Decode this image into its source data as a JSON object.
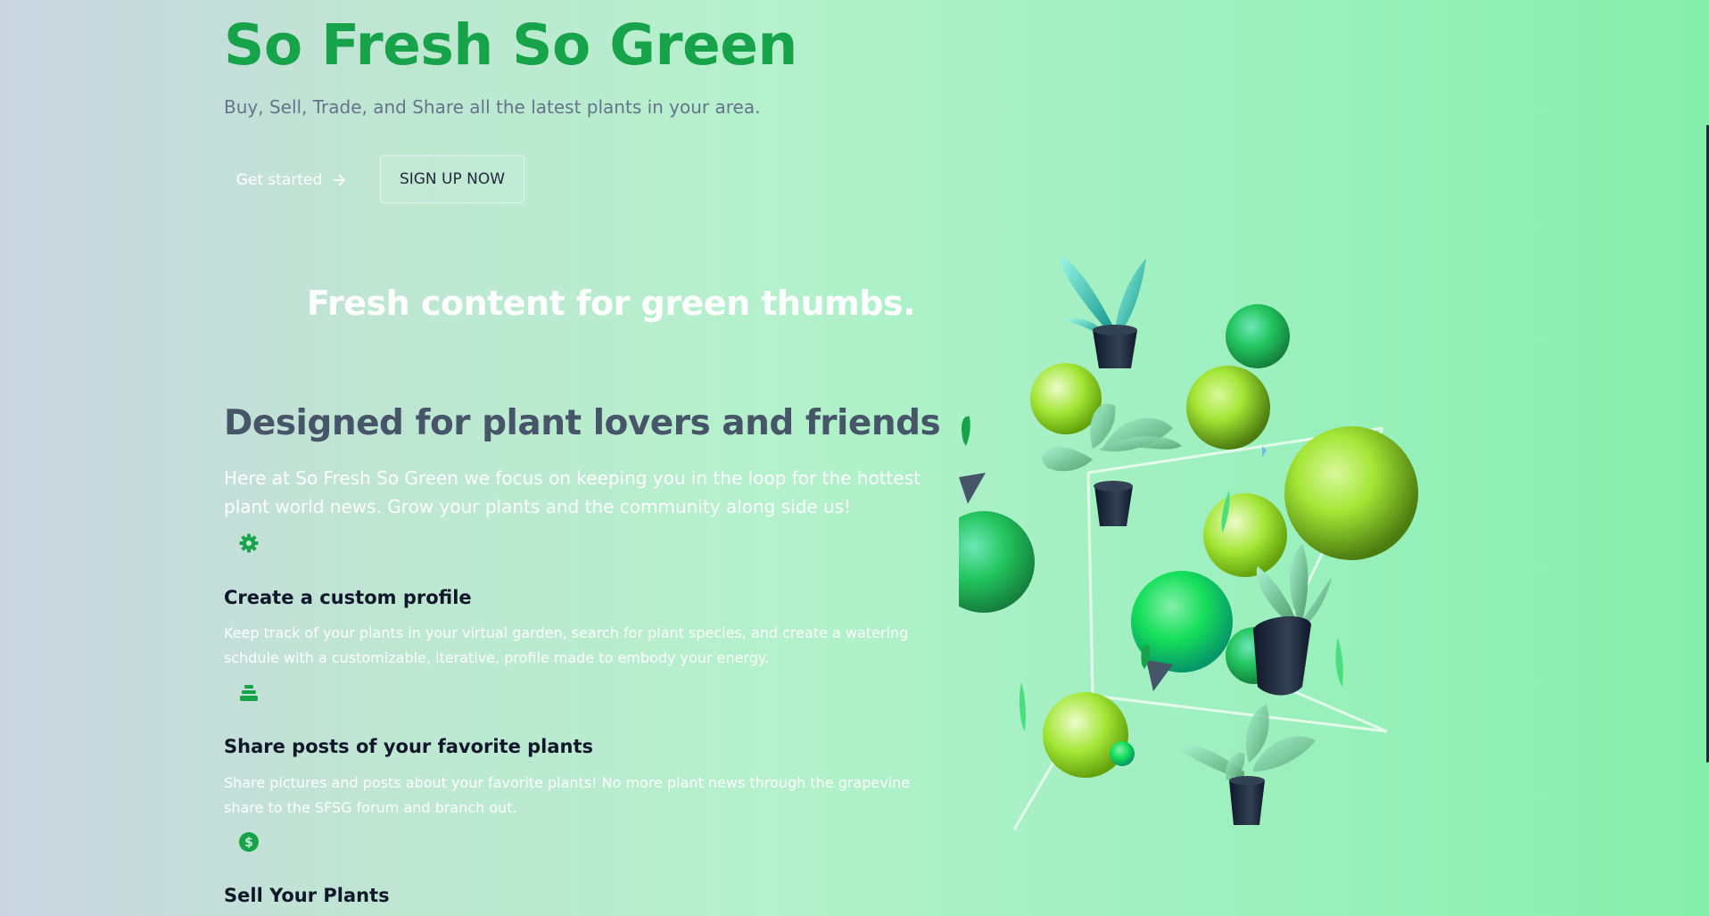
{
  "hero": {
    "title": "So Fresh So Green",
    "subtitle": "Buy, Sell, Trade, and Share all the latest plants in your area.",
    "get_started_label": "Get started",
    "signup_label": "SIGN UP NOW"
  },
  "tagline": "Fresh content for green thumbs.",
  "about": {
    "heading": "Designed for plant lovers and friends",
    "description": "Here at So Fresh So Green we focus on keeping you in the loop for the hottest plant world news. Grow your plants and the community along side us!"
  },
  "features": [
    {
      "icon": "gear-icon",
      "title": "Create a custom profile",
      "description": "Keep track of your plants in your virtual garden, search for plant species, and create a watering schdule with a customizable, iterative, profile made to embody your energy."
    },
    {
      "icon": "stack-icon",
      "title": "Share posts of your favorite plants",
      "description": "Share pictures and posts about your favorite plants! No more plant news through the grapevine share to the SFSG forum and branch out."
    },
    {
      "icon": "dollar-icon",
      "title": "Sell Your Plants",
      "description": ""
    }
  ],
  "colors": {
    "accent": "#16a34a",
    "heading": "#475569",
    "subtitle": "#64748b"
  }
}
